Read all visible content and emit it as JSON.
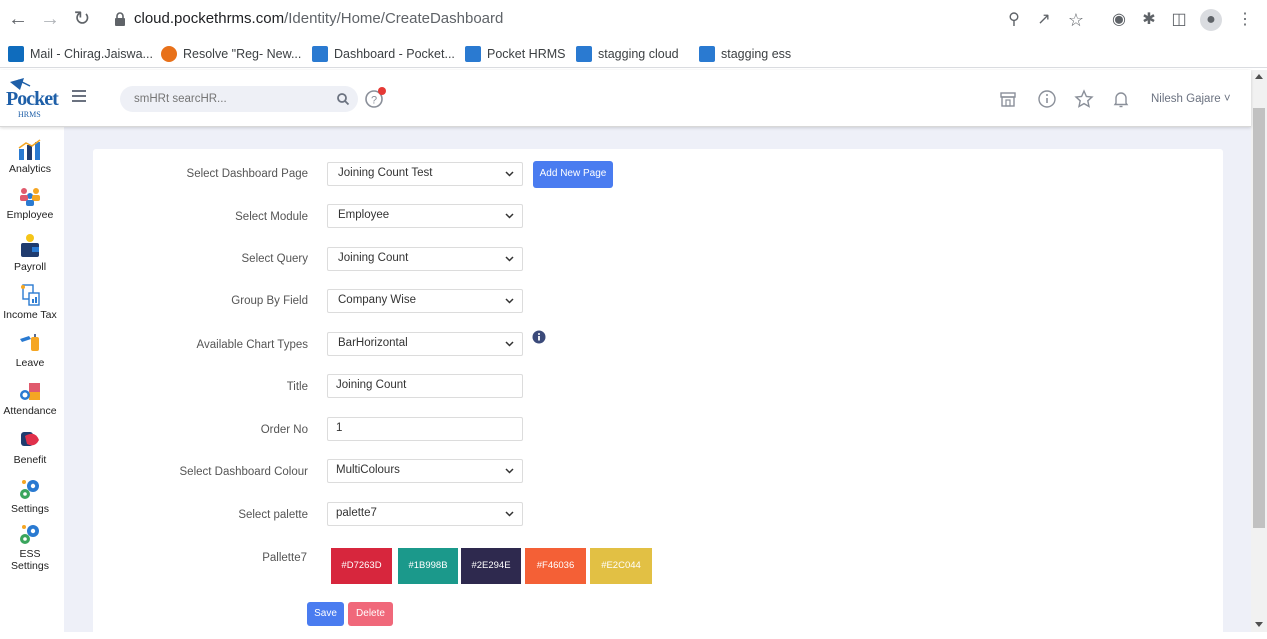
{
  "browser": {
    "url_host": "cloud.pockethrms.com",
    "url_path": "/Identity/Home/CreateDashboard",
    "bookmarks": [
      {
        "label": "Mail - Chirag.Jaiswa...",
        "icon": "outlook-icon",
        "color": "#0f6cbd"
      },
      {
        "label": "Resolve \"Reg- New...",
        "icon": "resolve-icon",
        "color": "#e8711a"
      },
      {
        "label": "Dashboard - Pocket...",
        "icon": "pocket-icon",
        "color": "#2a7ad1"
      },
      {
        "label": "Pocket HRMS",
        "icon": "pocket-icon",
        "color": "#2a7ad1"
      },
      {
        "label": "stagging cloud",
        "icon": "pocket-icon",
        "color": "#2a7ad1"
      },
      {
        "label": "stagging ess",
        "icon": "pocket-icon",
        "color": "#2a7ad1"
      }
    ]
  },
  "header": {
    "logo_text": "Pocket",
    "logo_sub": "HRMS",
    "search_placeholder": "smHRt searcHR...",
    "user_name": "Nilesh Gajare ˅"
  },
  "sidebar": {
    "items": [
      {
        "label": "Analytics",
        "icon": "analytics-icon"
      },
      {
        "label": "Employee",
        "icon": "employee-icon"
      },
      {
        "label": "Payroll",
        "icon": "payroll-icon"
      },
      {
        "label": "Income Tax",
        "icon": "income-tax-icon"
      },
      {
        "label": "Leave",
        "icon": "leave-icon"
      },
      {
        "label": "Attendance",
        "icon": "attendance-icon"
      },
      {
        "label": "Benefit",
        "icon": "benefit-icon"
      },
      {
        "label": "Settings",
        "icon": "settings-icon"
      },
      {
        "label": "ESS",
        "label2": "Settings",
        "icon": "ess-settings-icon"
      }
    ]
  },
  "form": {
    "dashboard_page": {
      "label": "Select Dashboard Page",
      "value": "Joining Count Test"
    },
    "add_new_page": "Add New Page",
    "module": {
      "label": "Select Module",
      "value": "Employee"
    },
    "query": {
      "label": "Select Query",
      "value": "Joining Count"
    },
    "group_by": {
      "label": "Group By Field",
      "value": "Company Wise"
    },
    "chart_type": {
      "label": "Available Chart Types",
      "value": "BarHorizontal"
    },
    "title": {
      "label": "Title",
      "value": "Joining Count"
    },
    "order_no": {
      "label": "Order No",
      "value": "1"
    },
    "dashboard_colour": {
      "label": "Select Dashboard Colour",
      "value": "MultiColours"
    },
    "palette": {
      "label": "Select palette",
      "value": "palette7"
    },
    "palette_label": "Pallette7",
    "swatches": [
      {
        "label": "#D7263D",
        "color": "#D7263D"
      },
      {
        "label": "#1B998B",
        "color": "#1B998B"
      },
      {
        "label": "#2E294E",
        "color": "#2E294E"
      },
      {
        "label": "#F46036",
        "color": "#F46036"
      },
      {
        "label": "#E2C044",
        "color": "#E2C044"
      }
    ],
    "save": "Save",
    "delete": "Delete"
  },
  "colors": {
    "primary_btn": "#4a7cf0",
    "delete_btn": "#f0687a",
    "page_bg": "#eef0f8"
  }
}
